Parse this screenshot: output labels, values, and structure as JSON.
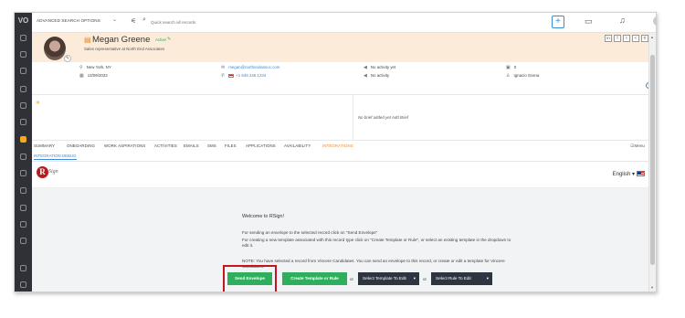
{
  "topbar": {
    "logo_text": "VO",
    "advanced_search": "ADVANCED SEARCH OPTIONS",
    "search_placeholder": "Quick search all records",
    "plus": "+",
    "chevron": "⌄"
  },
  "profile": {
    "name": "Megan Greene",
    "status": "Active",
    "subtitle": "Sales representative at North End Associates",
    "social": [
      "in",
      "f",
      "t",
      "<",
      "⚲"
    ],
    "expand": "▾"
  },
  "info": {
    "location": "New York, NY",
    "date": "13/09/2023",
    "email": "megan@northendassoc.com",
    "phone": "+1 646 245 1234",
    "activity_yet": "No activity yet",
    "no_activity": "No activity",
    "count": "0",
    "owner": "Ignacio Scena"
  },
  "panel": {
    "brief": "No brief added yet Add Brief"
  },
  "tabs": [
    "SUMMARY",
    "ONBOARDING",
    "WORK ASPIRATIONS",
    "ACTIVITIES",
    "EMAILS",
    "SMS",
    "FILES",
    "APPLICATIONS",
    "AVAILABILITY",
    "INTEGRATIONS"
  ],
  "menu_label": "Menu",
  "subtab": "INTEGRATION DEBUG",
  "rsign": {
    "logo_letter": "R",
    "logo_text": "Sign",
    "language": "English"
  },
  "main": {
    "welcome": "Welcome to RSign!",
    "p1": "For sending an envelope to the selected record click on \"Send Envelope\"",
    "p2": "For creating a new template associated with this record type click on \"Create Template or Rule\", or select an existing template in the dropdown to edit it.",
    "p3": "NOTE: You have selected a record from Vincere Candidates. You can send an envelope to this record, or create or edit a template for Vincere Candidates.",
    "send_button": "Send Envelope",
    "create_button": "Create Template or Rule",
    "or1": "or",
    "select_template": "Select Template To Edit",
    "or2": "or",
    "select_rule": "Select Rule To Edit"
  },
  "colors": {
    "accent_orange": "#e8892a",
    "link_blue": "#3a8ad6",
    "button_green": "#2fae5e",
    "button_dark": "#2e3540",
    "highlight_red": "#c0161f"
  }
}
